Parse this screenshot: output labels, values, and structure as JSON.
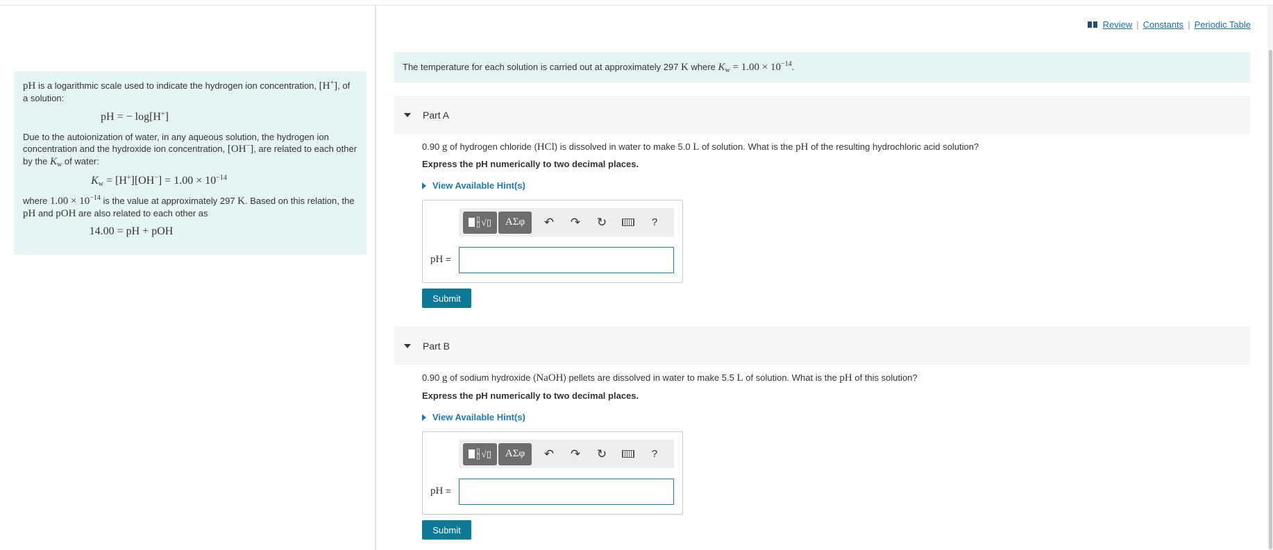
{
  "top_links": {
    "review": "Review",
    "separator": "|",
    "constants": "Constants",
    "periodic_table": "Periodic Table"
  },
  "intro": {
    "p1_mid": " is a logarithmic scale used to indicate the hydrogen ion concentration, ",
    "p1_end": ", of a solution:",
    "p2_a": "Due to the autoionization of water, in any aqueous solution, the hydrogen ion concentration and the hydroxide ion concentration, ",
    "p2_b": ", are related to each other by the ",
    "p2_c": " of water:",
    "p3_a": "where ",
    "p3_b": " is the value at approximately 297 ",
    "p3_c": ". Based on this relation, the ",
    "p3_d": " and ",
    "p3_e": " are also related to each other as"
  },
  "context": {
    "text_a": "The temperature for each solution is carried out at approximately 297 ",
    "text_b": " where "
  },
  "parts": [
    {
      "title": "Part A",
      "question_a": "0.90 ",
      "question_b": " of hydrogen chloride (",
      "question_c": ") is dissolved in water to make 5.0 ",
      "question_d": "  of solution. What is the ",
      "question_e": " of the resulting hydrochloric acid solution?",
      "instruction": "Express the pH numerically to two decimal places.",
      "hint_link": "View Available Hint(s)",
      "answer_label": "pH",
      "answer_value": "",
      "submit": "Submit"
    },
    {
      "title": "Part B",
      "question_a": "0.90 ",
      "question_b": " of sodium hydroxide (",
      "question_c": ") pellets are dissolved in water to make 5.5 ",
      "question_d": " of solution. What is the ",
      "question_e": " of this solution?",
      "instruction": "Express the pH numerically to two decimal places.",
      "hint_link": "View Available Hint(s)",
      "answer_label": "pH",
      "answer_value": "",
      "submit": "Submit"
    }
  ],
  "toolbar": {
    "templates_icon": "templates-icon",
    "symbols_label": "ΑΣφ",
    "undo_icon": "undo-icon",
    "redo_icon": "redo-icon",
    "reset_icon": "reset-icon",
    "keyboard_icon": "keyboard-icon",
    "help_label": "?"
  },
  "colors": {
    "info_panel_bg": "#e5f5f4",
    "link": "#1a7bae",
    "submit_bg": "#0f7a96",
    "part_header_bg": "#f5f5f5"
  }
}
